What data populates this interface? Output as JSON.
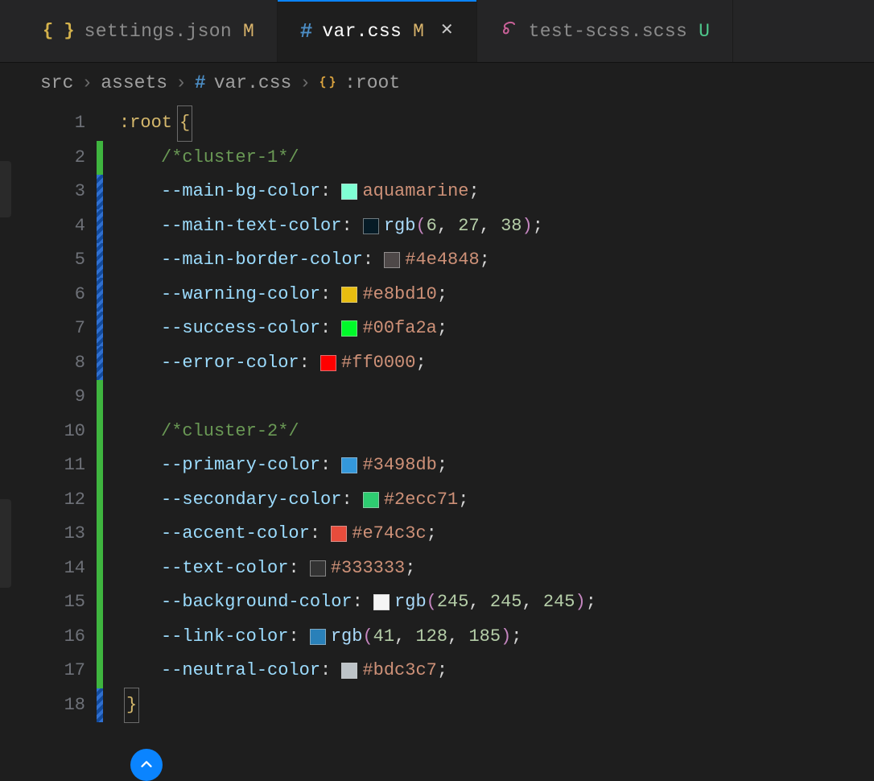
{
  "tabs": [
    {
      "icon": "json",
      "label": "settings.json",
      "status": "M",
      "status_class": "M",
      "closable": false,
      "active": false
    },
    {
      "icon": "hash",
      "label": "var.css",
      "status": "M",
      "status_class": "M",
      "closable": true,
      "active": true
    },
    {
      "icon": "sass",
      "label": "test-scss.scss",
      "status": "U",
      "status_class": "U",
      "closable": false,
      "active": false
    }
  ],
  "breadcrumb": {
    "parts": [
      "src",
      "assets"
    ],
    "file_icon": "hash",
    "file": "var.css",
    "symbol_icon": "braces",
    "symbol": ":root"
  },
  "code": {
    "selector": ":root",
    "open_brace": "{",
    "close_brace": "}",
    "lines": [
      {
        "n": 1,
        "bar": "",
        "kind": "selector"
      },
      {
        "n": 2,
        "bar": "green",
        "kind": "comment",
        "text": "/*cluster-1*/"
      },
      {
        "n": 3,
        "bar": "blue",
        "kind": "decl",
        "prop": "--main-bg-color",
        "swatch": "#7fffd4",
        "value_kind": "name",
        "value": "aquamarine"
      },
      {
        "n": 4,
        "bar": "blue",
        "kind": "decl",
        "prop": "--main-text-color",
        "swatch": "#061b26",
        "value_kind": "rgb",
        "fn": "rgb",
        "args": [
          "6",
          "27",
          "38"
        ]
      },
      {
        "n": 5,
        "bar": "blue",
        "kind": "decl",
        "prop": "--main-border-color",
        "swatch": "#4e4848",
        "value_kind": "name",
        "value": "#4e4848"
      },
      {
        "n": 6,
        "bar": "blue",
        "kind": "decl",
        "prop": "--warning-color",
        "swatch": "#e8bd10",
        "value_kind": "name",
        "value": "#e8bd10"
      },
      {
        "n": 7,
        "bar": "blue",
        "kind": "decl",
        "prop": "--success-color",
        "swatch": "#00fa2a",
        "value_kind": "name",
        "value": "#00fa2a"
      },
      {
        "n": 8,
        "bar": "blue",
        "kind": "decl",
        "prop": "--error-color",
        "swatch": "#ff0000",
        "value_kind": "name",
        "value": "#ff0000"
      },
      {
        "n": 9,
        "bar": "green",
        "kind": "blank"
      },
      {
        "n": 10,
        "bar": "green",
        "kind": "comment",
        "text": "/*cluster-2*/"
      },
      {
        "n": 11,
        "bar": "green",
        "kind": "decl",
        "prop": "--primary-color",
        "swatch": "#3498db",
        "value_kind": "name",
        "value": "#3498db"
      },
      {
        "n": 12,
        "bar": "green",
        "kind": "decl",
        "prop": "--secondary-color",
        "swatch": "#2ecc71",
        "value_kind": "name",
        "value": "#2ecc71"
      },
      {
        "n": 13,
        "bar": "green",
        "kind": "decl",
        "prop": "--accent-color",
        "swatch": "#e74c3c",
        "value_kind": "name",
        "value": "#e74c3c"
      },
      {
        "n": 14,
        "bar": "green",
        "kind": "decl",
        "prop": "--text-color",
        "swatch": "#333333",
        "value_kind": "name",
        "value": "#333333"
      },
      {
        "n": 15,
        "bar": "green",
        "kind": "decl",
        "prop": "--background-color",
        "swatch": "#f5f5f5",
        "value_kind": "rgb",
        "fn": "rgb",
        "args": [
          "245",
          "245",
          "245"
        ]
      },
      {
        "n": 16,
        "bar": "green",
        "kind": "decl",
        "prop": "--link-color",
        "swatch": "#2980b9",
        "value_kind": "rgb",
        "fn": "rgb",
        "args": [
          "41",
          "128",
          "185"
        ]
      },
      {
        "n": 17,
        "bar": "green",
        "kind": "decl",
        "prop": "--neutral-color",
        "swatch": "#bdc3c7",
        "value_kind": "name",
        "value": "#bdc3c7"
      },
      {
        "n": 18,
        "bar": "blue",
        "kind": "close"
      }
    ]
  }
}
